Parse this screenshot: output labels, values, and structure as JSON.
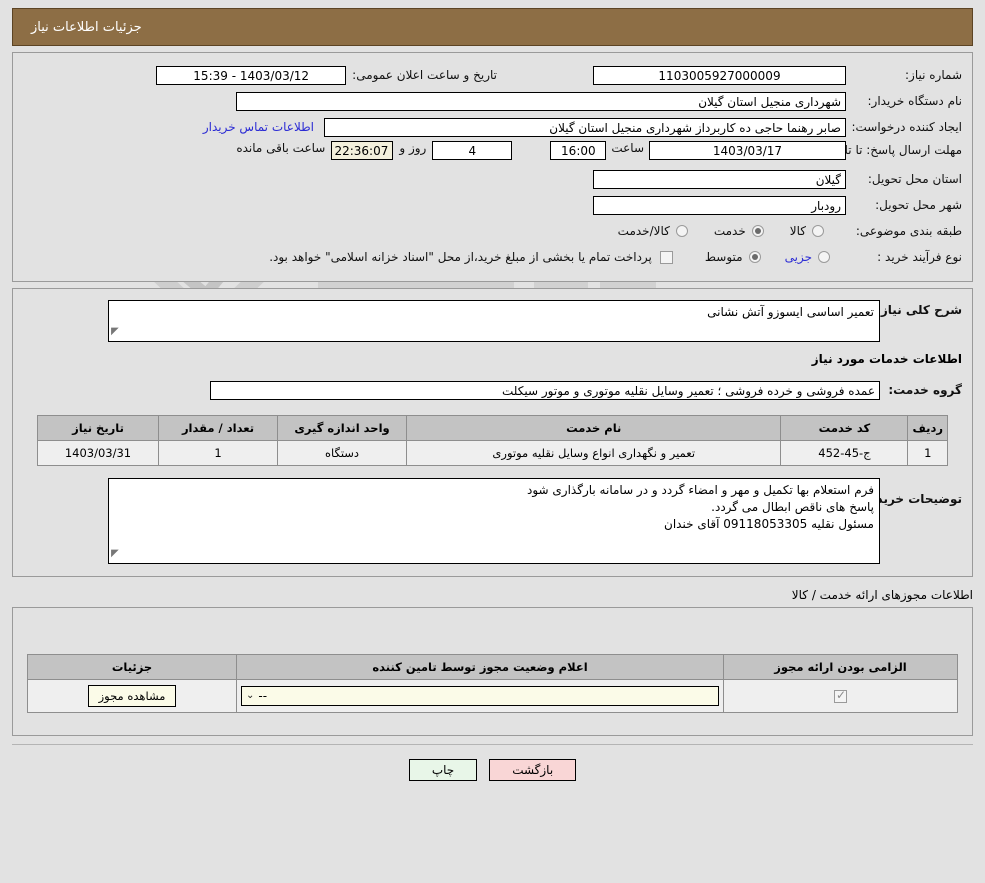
{
  "header": {
    "title": "جزئیات اطلاعات نیاز",
    "bar_color": "#8d6e45"
  },
  "top_form": {
    "need_number_label": "شماره نیاز:",
    "need_number_value": "1103005927000009",
    "announce_label": "تاریخ و ساعت اعلان عمومی:",
    "announce_value": "1403/03/12 - 15:39",
    "buyer_org_label": "نام دستگاه خریدار:",
    "buyer_org_value": "شهرداری منجیل استان گیلان",
    "creator_label": "ایجاد کننده درخواست:",
    "creator_value": "صابر رهنما حاجی ده کاربرداز شهرداری منجیل استان گیلان",
    "contact_link": "اطلاعات تماس خریدار",
    "deadline_label": "مهلت ارسال پاسخ: تا تاریخ:",
    "deadline_date": "1403/03/17",
    "deadline_hour_label": "ساعت",
    "deadline_hour": "16:00",
    "remaining_days": "4",
    "remaining_days_unit": "روز و",
    "remaining_clock": "22:36:07",
    "remaining_suffix": "ساعت باقی مانده",
    "province_label": "استان محل تحویل:",
    "province_value": "گیلان",
    "city_label": "شهر محل تحویل:",
    "city_value": "رودبار",
    "category_label": "طبقه بندی موضوعی:",
    "category_options": [
      {
        "label": "کالا",
        "selected": false
      },
      {
        "label": "خدمت",
        "selected": true
      },
      {
        "label": "کالا/خدمت",
        "selected": false
      }
    ],
    "process_label": "نوع فرآیند خرید :",
    "process_options": [
      {
        "label": "جزیی",
        "selected": false
      },
      {
        "label": "متوسط",
        "selected": true
      }
    ],
    "payment_checkbox_checked": false,
    "payment_note": "پرداخت تمام یا بخشی از مبلغ خرید،از محل \"اسناد خزانه اسلامی\" خواهد بود."
  },
  "general": {
    "label": "شرح کلی نیاز:",
    "value": "تعمیر اساسی ایسوزو آتش نشانی"
  },
  "services_section": {
    "title": "اطلاعات خدمات مورد نیاز",
    "group_label": "گروه خدمت:",
    "group_value": "عمده فروشی و خرده فروشی ؛ تعمیر وسایل نقلیه موتوری و موتور سیکلت",
    "table": {
      "headers": [
        "ردیف",
        "کد خدمت",
        "نام خدمت",
        "واحد اندازه گیری",
        "تعداد / مقدار",
        "تاریخ نیاز"
      ],
      "rows": [
        {
          "row_no": "1",
          "service_code": "ج-45-452",
          "service_name": "تعمیر و نگهداری انواع وسایل نقلیه موتوری",
          "unit": "دستگاه",
          "quantity": "1",
          "need_date": "1403/03/31"
        }
      ]
    },
    "notes_label": "توضیحات خریدار:",
    "notes_lines": [
      "فرم استعلام بها تکمیل و مهر و امضاء گردد و در سامانه بارگذاری شود",
      "پاسخ های ناقص ابطال می گردد.",
      "مسئول نقلیه 09118053305 آقای خندان"
    ]
  },
  "permits_section": {
    "title": "اطلاعات مجوزهای ارائه خدمت / کالا",
    "table": {
      "headers": [
        "الزامی بودن ارائه مجوز",
        "اعلام وضعیت مجوز توسط تامین کننده",
        "جزئیات"
      ],
      "rows": [
        {
          "required_checked": true,
          "status_value": "--",
          "details_button": "مشاهده مجوز"
        }
      ]
    }
  },
  "footer": {
    "print_label": "چاپ",
    "back_label": "بازگشت"
  }
}
